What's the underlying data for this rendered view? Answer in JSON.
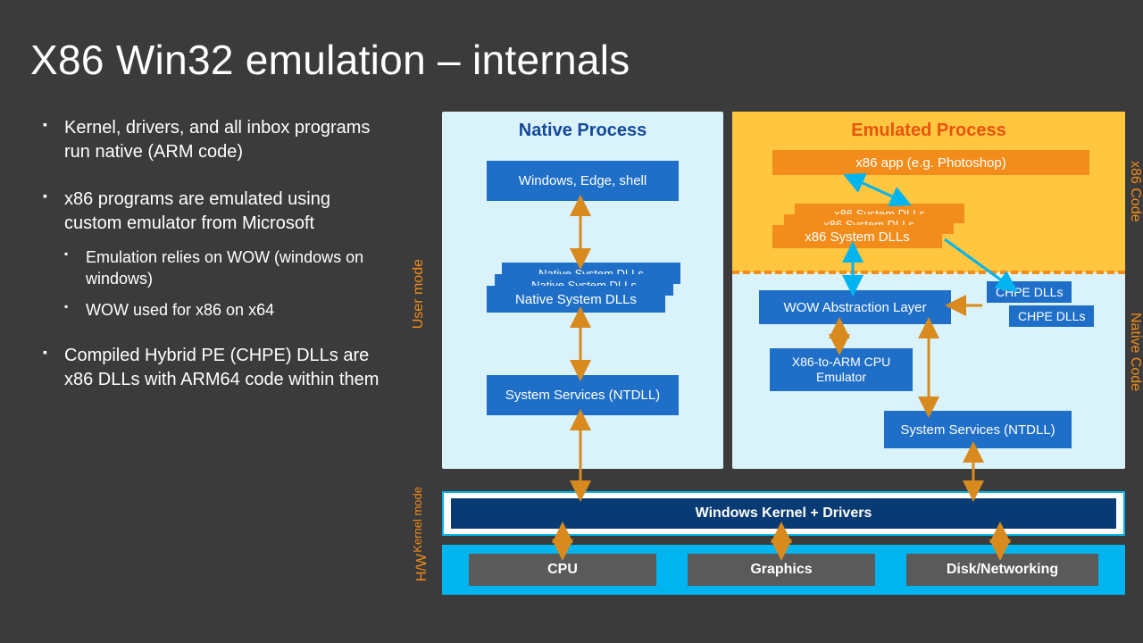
{
  "title": "X86 Win32 emulation – internals",
  "bullets": {
    "b1": "Kernel, drivers, and all inbox programs run native (ARM code)",
    "b2": "x86 programs are emulated using custom emulator from Microsoft",
    "b2a": "Emulation relies on WOW (windows on windows)",
    "b2b": "WOW used for x86 on x64",
    "b3": "Compiled Hybrid PE (CHPE) DLLs are x86 DLLs with ARM64 code within them"
  },
  "labels": {
    "user_mode": "User mode",
    "kernel_mode": "Kernel mode",
    "hw": "H/W",
    "x86_code": "x86 Code",
    "native_code": "Native Code"
  },
  "native": {
    "title": "Native Process",
    "top_box": "Windows, Edge, shell",
    "dll_stack_a": "Native System DLLs",
    "dll_stack_b": "Native System DLLs",
    "dll_stack_c": "Native System DLLs",
    "ntdll": "System Services (NTDLL)"
  },
  "emul": {
    "title": "Emulated Process",
    "app": "x86 app (e.g. Photoshop)",
    "dll_a": "x86 System DLLs",
    "dll_b": "x86 System DLLs",
    "dll_c": "x86 System DLLs",
    "wow": "WOW Abstraction Layer",
    "emu": "X86-to-ARM CPU Emulator",
    "ntdll": "System Services (NTDLL)",
    "chpe1": "CHPE DLLs",
    "chpe2": "CHPE DLLs"
  },
  "kernel": "Windows Kernel + Drivers",
  "hw": {
    "cpu": "CPU",
    "gfx": "Graphics",
    "disk": "Disk/Networking"
  }
}
